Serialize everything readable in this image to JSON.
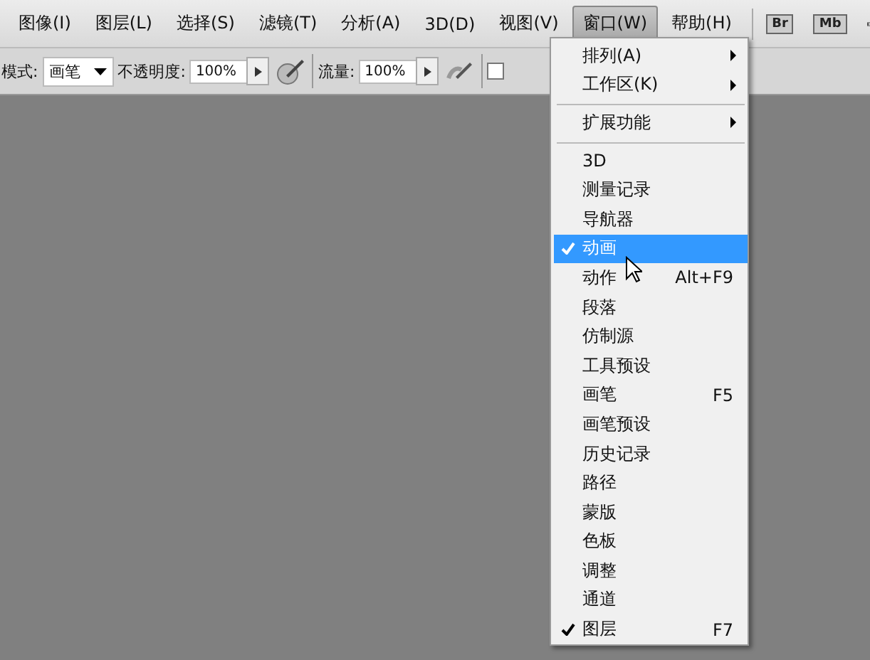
{
  "menu_bar": {
    "items": [
      {
        "label": "图像(I)",
        "selected": false
      },
      {
        "label": "图层(L)",
        "selected": false
      },
      {
        "label": "选择(S)",
        "selected": false
      },
      {
        "label": "滤镜(T)",
        "selected": false
      },
      {
        "label": "分析(A)",
        "selected": false
      },
      {
        "label": "3D(D)",
        "selected": false
      },
      {
        "label": "视图(V)",
        "selected": false
      },
      {
        "label": "窗口(W)",
        "selected": true
      },
      {
        "label": "帮助(H)",
        "selected": false
      }
    ],
    "apps": [
      "Br",
      "Mb"
    ]
  },
  "options_bar": {
    "mode_label": "模式:",
    "mode_value": "画笔",
    "opacity_label": "不透明度:",
    "opacity_value": "100%",
    "flow_label": "流量:",
    "flow_value": "100%",
    "checkbox": {
      "checked": false
    }
  },
  "window_menu": {
    "groups": [
      [
        {
          "label": "排列(A)",
          "submenu": true,
          "checked": false,
          "selected": false
        },
        {
          "label": "工作区(K)",
          "submenu": true,
          "checked": false,
          "selected": false
        }
      ],
      [
        {
          "label": "扩展功能",
          "submenu": true,
          "checked": false,
          "selected": false
        }
      ],
      [
        {
          "label": "3D",
          "submenu": false,
          "checked": false,
          "selected": false
        },
        {
          "label": "测量记录",
          "submenu": false,
          "checked": false,
          "selected": false
        },
        {
          "label": "导航器",
          "submenu": false,
          "checked": false,
          "selected": false
        },
        {
          "label": "动画",
          "submenu": false,
          "checked": true,
          "selected": true
        },
        {
          "label": "动作",
          "shortcut": "Alt+F9",
          "submenu": false,
          "checked": false,
          "selected": false
        },
        {
          "label": "段落",
          "submenu": false,
          "checked": false,
          "selected": false
        },
        {
          "label": "仿制源",
          "submenu": false,
          "checked": false,
          "selected": false
        },
        {
          "label": "工具预设",
          "submenu": false,
          "checked": false,
          "selected": false
        },
        {
          "label": "画笔",
          "shortcut": "F5",
          "submenu": false,
          "checked": false,
          "selected": false
        },
        {
          "label": "画笔预设",
          "submenu": false,
          "checked": false,
          "selected": false
        },
        {
          "label": "历史记录",
          "submenu": false,
          "checked": false,
          "selected": false
        },
        {
          "label": "路径",
          "submenu": false,
          "checked": false,
          "selected": false
        },
        {
          "label": "蒙版",
          "submenu": false,
          "checked": false,
          "selected": false
        },
        {
          "label": "色板",
          "submenu": false,
          "checked": false,
          "selected": false
        },
        {
          "label": "调整",
          "submenu": false,
          "checked": false,
          "selected": false
        },
        {
          "label": "通道",
          "submenu": false,
          "checked": false,
          "selected": false
        },
        {
          "label": "图层",
          "shortcut": "F7",
          "submenu": false,
          "checked": true,
          "selected": false
        }
      ]
    ]
  }
}
